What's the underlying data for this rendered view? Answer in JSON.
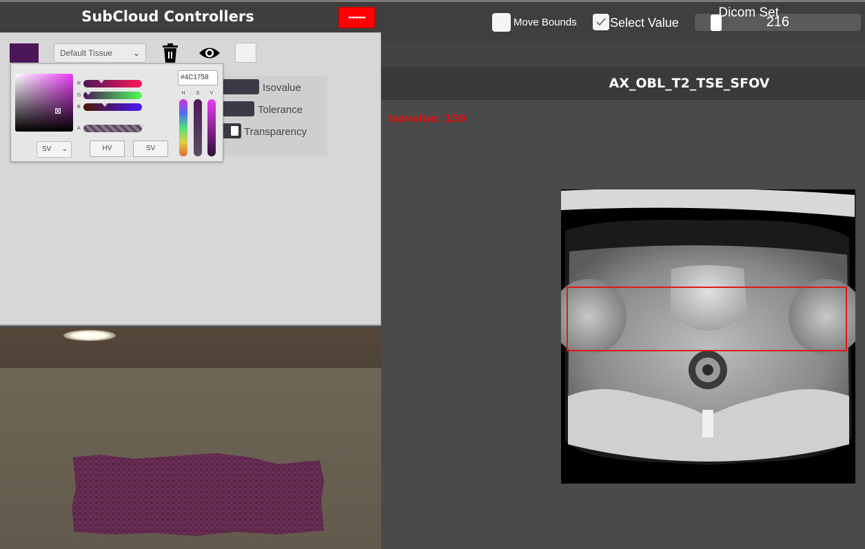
{
  "left_panel": {
    "title": "SubCloud Controllers",
    "close_label": "-----",
    "tissue_select": {
      "value": "Default Tissue"
    },
    "tissue_color": "#4C1758",
    "fields": {
      "isovalue_label": "Isovalue",
      "tolerance_label": "Tolerance",
      "transparency_label": "Transparency"
    },
    "color_picker": {
      "hex_value": "#4C1758",
      "channels": [
        "R",
        "G",
        "B",
        "A"
      ],
      "vertical_channels": [
        "H",
        "S",
        "V"
      ],
      "mode_select": "SV",
      "buttons": [
        "HV",
        "SV"
      ]
    }
  },
  "right_panel": {
    "move_bounds_label": "Move Bounds",
    "move_bounds_checked": false,
    "select_value_label": "Select Value",
    "select_value_checked": true,
    "slider_value": "216",
    "dicom_set_label": "Dicom Set",
    "series_name": "AX_OBL_T2_TSE_SFOV",
    "isovalue_readout": "Isovalue: 159"
  },
  "colors": {
    "close_button": "#FF0000",
    "roi_box": "#E01818",
    "iso_text": "#E01010"
  },
  "icons": [
    "trash-icon",
    "eye-icon",
    "check-icon",
    "chevron-down-icon",
    "crosshair-icon"
  ]
}
